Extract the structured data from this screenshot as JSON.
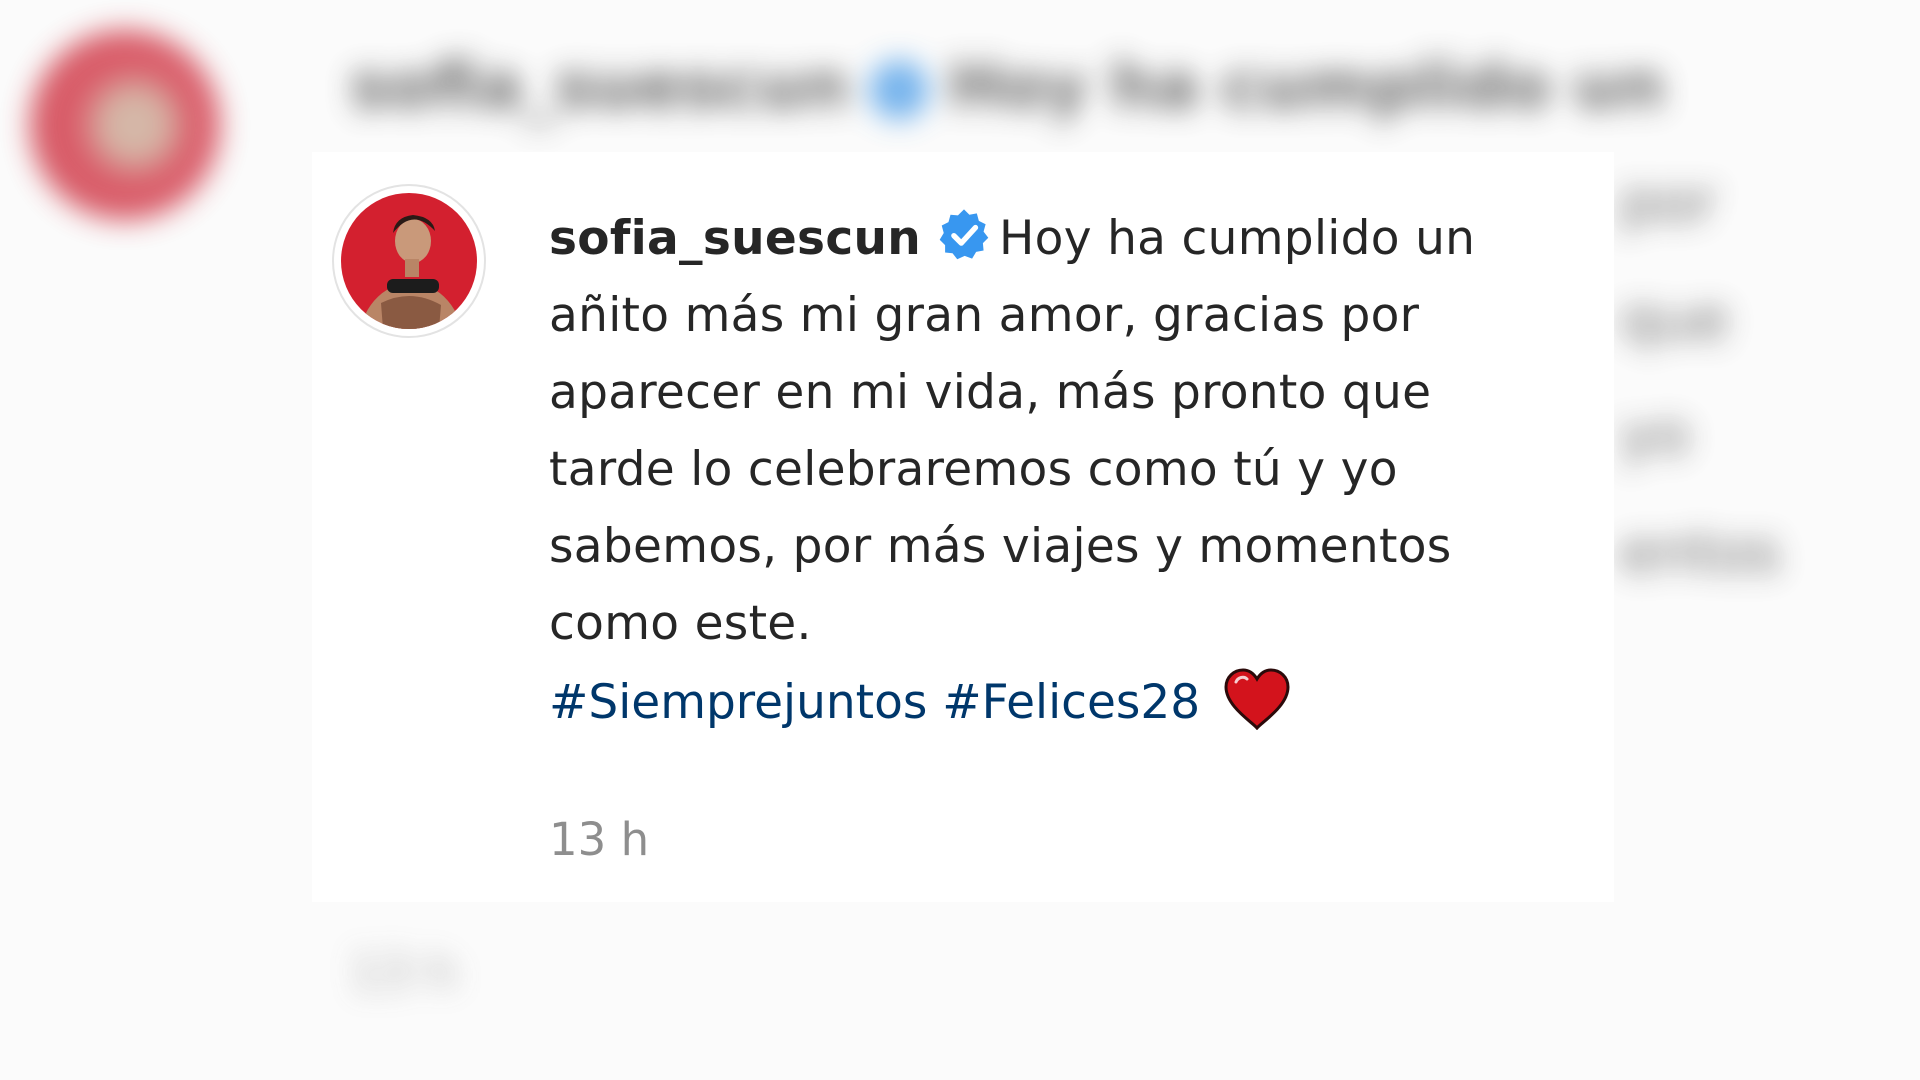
{
  "post": {
    "username": "sofia_suescun",
    "verified_icon": "verified-badge-icon",
    "caption_lines": [
      "Hoy ha cumplido un",
      "añito más mi gran amor, gracias por",
      "aparecer en mi vida, más pronto que",
      "tarde lo celebraremos como tú y yo",
      "sabemos, por más viajes y momentos",
      "como este."
    ],
    "hashtags": [
      "#Siemprejuntos",
      "#Felices28"
    ],
    "emoji": "heart-icon",
    "timestamp": "13 h"
  },
  "colors": {
    "verified": "#3897f0",
    "hashtag": "#00376b",
    "heart": "#d3131c",
    "text": "#262626",
    "muted": "#8e8e8e"
  }
}
